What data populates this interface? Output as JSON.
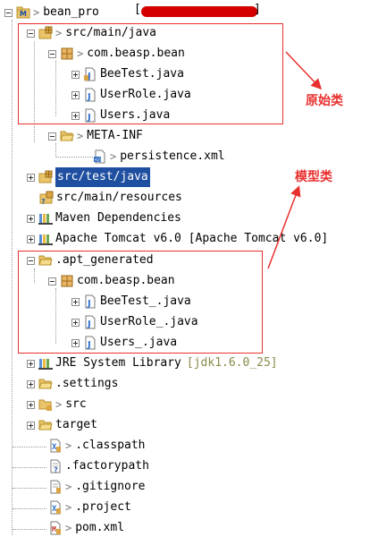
{
  "project": {
    "name": "bean_pro"
  },
  "nodes": {
    "src_main_java": {
      "label": "src/main/java"
    },
    "pkg_main": {
      "label": "com.beasp.bean"
    },
    "beetest": {
      "label": "BeeTest.java"
    },
    "userrole": {
      "label": "UserRole.java"
    },
    "users": {
      "label": "Users.java"
    },
    "metainf": {
      "label": "META-INF"
    },
    "persistence": {
      "label": "persistence.xml"
    },
    "src_test_java": {
      "label": "src/test/java"
    },
    "src_main_resources": {
      "label": "src/main/resources"
    },
    "maven": {
      "label": "Maven Dependencies"
    },
    "tomcat": {
      "label": "Apache Tomcat v6.0 [Apache Tomcat v6.0]"
    },
    "apt": {
      "label": ".apt_generated"
    },
    "pkg_apt": {
      "label": "com.beasp.bean"
    },
    "beetest_": {
      "label": "BeeTest_.java"
    },
    "userrole_": {
      "label": "UserRole_.java"
    },
    "users_": {
      "label": "Users_.java"
    },
    "jre": {
      "label": "JRE System Library",
      "extra": "[jdk1.6.0_25]"
    },
    "settings": {
      "label": ".settings"
    },
    "src": {
      "label": "src"
    },
    "target": {
      "label": "target"
    },
    "classpath": {
      "label": ".classpath"
    },
    "factorypath": {
      "label": ".factorypath"
    },
    "gitignore": {
      "label": ".gitignore"
    },
    "project_file": {
      "label": ".project"
    },
    "pom": {
      "label": "pom.xml"
    }
  },
  "annotations": {
    "original_classes": "原始类",
    "model_classes": "模型类",
    "color": "#e8312f"
  },
  "colors": {
    "selection": "#1f4fa0",
    "folder": "#e9c46a",
    "java": "#2f6fd0"
  }
}
